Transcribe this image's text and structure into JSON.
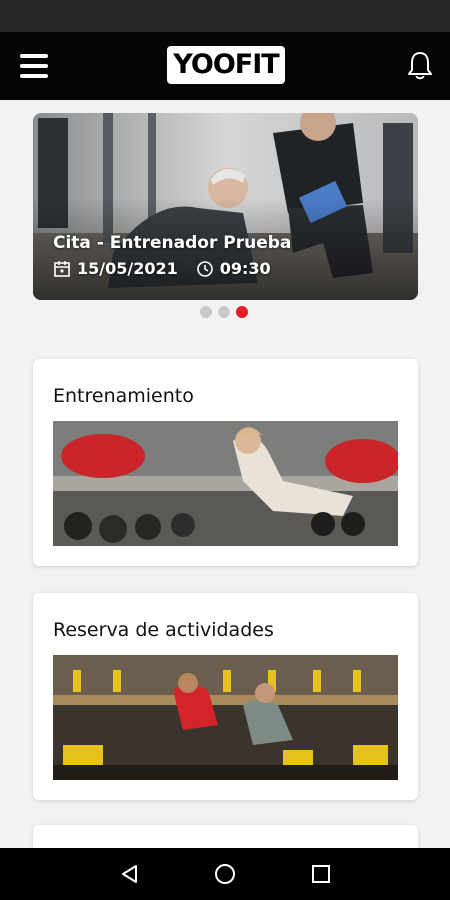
{
  "header": {
    "logo_text": "YOOFIT",
    "menu_icon": "hamburger-menu-icon",
    "notification_icon": "bell-icon"
  },
  "hero": {
    "title": "Cita - Entrenador Prueba",
    "date": "15/05/2021",
    "time": "09:30",
    "slides": 3,
    "active_slide": 3
  },
  "cards": [
    {
      "title": "Entrenamiento"
    },
    {
      "title": "Reserva de actividades"
    }
  ],
  "colors": {
    "accent": "#e41e26",
    "header_bg": "#050505",
    "page_bg": "#f2f2f2"
  },
  "nav": {
    "back_icon": "back-triangle-icon",
    "home_icon": "home-circle-icon",
    "recents_icon": "recents-square-icon"
  }
}
